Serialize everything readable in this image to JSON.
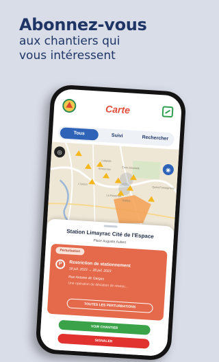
{
  "headline": {
    "line1": "Abonnez-vous",
    "line2": "aux chantiers qui",
    "line3": "vous intéressent"
  },
  "app": {
    "title": "Carte",
    "tabs": [
      "Tous",
      "Suivi",
      "Rechercher"
    ],
    "active_tab": "Tous"
  },
  "map": {
    "places": [
      "Saint-Jean",
      "Lalande",
      "Amouroux",
      "La Roseraie",
      "L'Union",
      "Croix-Daurade",
      "Quint-Fonsegrives",
      "Balma",
      "Rangueil"
    ]
  },
  "station": {
    "name": "Station Limayrac Cité de l'Espace",
    "address": "Place Auguste Aubert"
  },
  "perturbation": {
    "badge": "Perturbation",
    "title": "Restriction de stationnement",
    "dates": "18 juil. 2023 → 28 juil. 2023",
    "street": "Rue Antoine de Gargas",
    "description": "Une opération de déviation de réseau...",
    "all_button": "TOUTES LES PERTURBATIONS"
  },
  "actions": {
    "view": "VOIR CHANTIER",
    "report": "SIGNALER"
  },
  "colors": {
    "brand_navy": "#1e3566",
    "accent_red": "#e24c3a",
    "card_orange": "#e46a4b",
    "green": "#3aa34a"
  }
}
